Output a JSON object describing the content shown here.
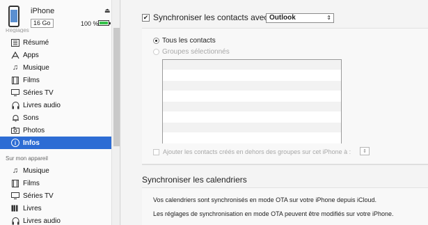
{
  "device": {
    "name": "iPhone",
    "capacity": "16 Go",
    "battery_percent": "100 %",
    "battery_level": 1.0,
    "section_heading_cut": "Réglages"
  },
  "sidebar": {
    "settings_items": [
      {
        "label": "Résumé",
        "icon": "summary-icon"
      },
      {
        "label": "Apps",
        "icon": "apps-icon"
      },
      {
        "label": "Musique",
        "icon": "music-icon"
      },
      {
        "label": "Films",
        "icon": "film-icon"
      },
      {
        "label": "Séries TV",
        "icon": "tv-icon"
      },
      {
        "label": "Livres audio",
        "icon": "audiobook-icon"
      },
      {
        "label": "Sons",
        "icon": "bell-icon"
      },
      {
        "label": "Photos",
        "icon": "camera-icon"
      },
      {
        "label": "Infos",
        "icon": "info-icon",
        "active": true
      }
    ],
    "on_device_heading": "Sur mon appareil",
    "device_items": [
      {
        "label": "Musique",
        "icon": "music-icon"
      },
      {
        "label": "Films",
        "icon": "film-icon"
      },
      {
        "label": "Séries TV",
        "icon": "tv-icon"
      },
      {
        "label": "Livres",
        "icon": "book-icon"
      },
      {
        "label": "Livres audio",
        "icon": "audiobook-icon"
      }
    ],
    "active_color": "#2d6cd4"
  },
  "contacts": {
    "sync_label": "Synchroniser les contacts avec",
    "sync_checked": true,
    "source_selected": "Outlook",
    "radio_all": "Tous les contacts",
    "radio_groups": "Groupes sélectionnés",
    "add_contacts_label": "Ajouter les contacts créés en dehors des groupes sur cet iPhone à :"
  },
  "calendars": {
    "title": "Synchroniser les calendriers",
    "line1": "Vos calendriers sont synchronisés en mode OTA sur votre iPhone depuis iCloud.",
    "line2": "Les réglages de synchronisation en mode OTA peuvent être modifiés sur votre iPhone."
  }
}
